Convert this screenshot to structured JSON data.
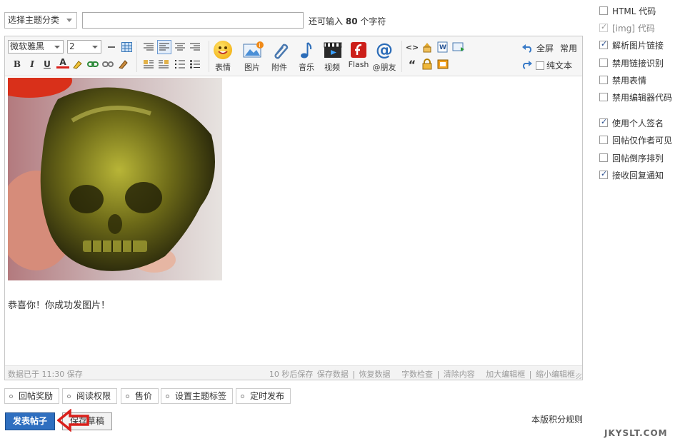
{
  "topbar": {
    "type_select": "选择主题分类",
    "subject_placeholder": "",
    "char_hint_prefix": "还可输入",
    "char_hint_count": "80",
    "char_hint_suffix": "个字符"
  },
  "toolbar": {
    "font": "微软雅黑",
    "size": "2",
    "bold": "B",
    "italic": "I",
    "underline": "U",
    "font_color": "A",
    "emoticon": "表情",
    "image": "图片",
    "attachment": "附件",
    "music": "音乐",
    "video": "视频",
    "flash": "Flash",
    "at_friend": "@朋友",
    "code": "<>",
    "quote": "“",
    "fullscreen": "全屏",
    "common": "常用",
    "plaintext": "纯文本"
  },
  "content": {
    "message": "恭喜你！你成功发图片！"
  },
  "statusbar": {
    "saved": "数据已于 11:30 保存",
    "autosave": "10 秒后保存",
    "save_data": "保存数据",
    "restore_data": "恢复数据",
    "word_check": "字数检查",
    "clear": "清除内容",
    "enlarge": "加大编辑框",
    "shrink": "缩小编辑框",
    "sep": "|"
  },
  "extras": [
    "回帖奖励",
    "阅读权限",
    "售价",
    "设置主题标签",
    "定时发布"
  ],
  "actions": {
    "submit": "发表帖子",
    "draft": "保存草稿",
    "rules": "本版积分规则"
  },
  "watermark": "JKYSLT.COM",
  "options": [
    {
      "label": "HTML 代码",
      "checked": false,
      "disabled": false
    },
    {
      "label": "[img] 代码",
      "checked": true,
      "disabled": true
    },
    {
      "label": "解析图片链接",
      "checked": true,
      "disabled": false
    },
    {
      "label": "禁用链接识别",
      "checked": false,
      "disabled": false
    },
    {
      "label": "禁用表情",
      "checked": false,
      "disabled": false
    },
    {
      "label": "禁用编辑器代码",
      "checked": false,
      "disabled": false
    },
    {
      "label": "使用个人签名",
      "checked": true,
      "disabled": false
    },
    {
      "label": "回帖仅作者可见",
      "checked": false,
      "disabled": false
    },
    {
      "label": "回帖倒序排列",
      "checked": false,
      "disabled": false
    },
    {
      "label": "接收回复通知",
      "checked": true,
      "disabled": false
    }
  ],
  "colors": {
    "submit_bg": "#2f6fc0",
    "arrow_red": "#d9201b"
  }
}
